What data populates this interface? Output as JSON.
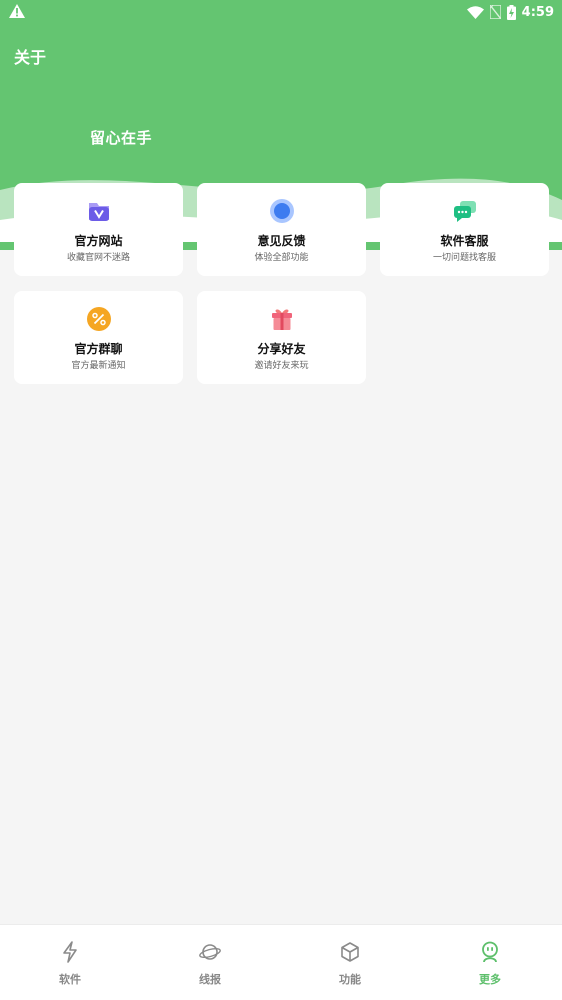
{
  "status_bar": {
    "time": "4:59"
  },
  "header": {
    "title": "关于",
    "slogan": "留心在手"
  },
  "cards": [
    {
      "title": "官方网站",
      "subtitle": "收藏官网不迷路",
      "icon": "website-icon"
    },
    {
      "title": "意见反馈",
      "subtitle": "体验全部功能",
      "icon": "feedback-icon"
    },
    {
      "title": "软件客服",
      "subtitle": "一切问题找客服",
      "icon": "chat-icon"
    },
    {
      "title": "官方群聊",
      "subtitle": "官方最新通知",
      "icon": "group-chat-icon"
    },
    {
      "title": "分享好友",
      "subtitle": "邀请好友来玩",
      "icon": "gift-icon"
    }
  ],
  "bottom_nav": [
    {
      "label": "软件",
      "icon": "lightning-icon",
      "active": false
    },
    {
      "label": "线报",
      "icon": "planet-icon",
      "active": false
    },
    {
      "label": "功能",
      "icon": "cube-icon",
      "active": false
    },
    {
      "label": "更多",
      "icon": "robot-icon",
      "active": true
    }
  ],
  "colors": {
    "primary": "#64c571",
    "active_nav": "#5dbf6b",
    "background": "#f5f5f5"
  }
}
